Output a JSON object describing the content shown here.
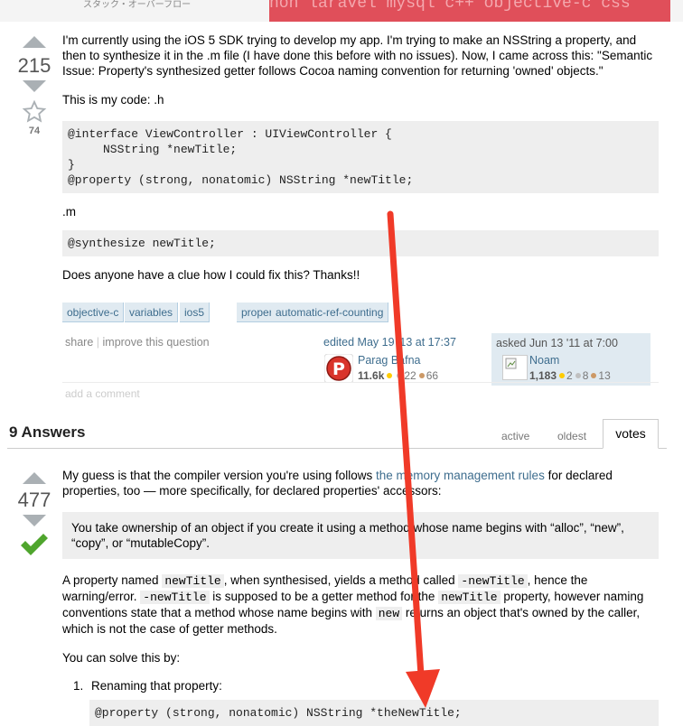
{
  "header": {
    "site_name_jp": "スタック・オーバーフロー",
    "tags_strip": "hon laravel mysql c++ objective-c css"
  },
  "question": {
    "votes": "215",
    "favorites": "74",
    "body_p1": "I'm currently using the iOS 5 SDK trying to develop my app. I'm trying to make an NSString a property, and then to synthesize it in the .m file (I have done this before with no issues). Now, I came across this: \"Semantic Issue: Property's synthesized getter follows Cocoa naming convention for returning 'owned' objects.\"",
    "body_p2": "This is my code: .h",
    "code_h": "@interface ViewController : UIViewController {\n     NSString *newTitle;\n}\n@property (strong, nonatomic) NSString *newTitle;",
    "body_p3": ".m",
    "code_m": "@synthesize newTitle;",
    "body_p4": "Does anyone have a clue how I could fix this? Thanks!!",
    "tags": [
      "objective-c",
      "variables",
      "ios5",
      "properties",
      "automatic-ref-counting"
    ],
    "share": "share",
    "separator": "|",
    "improve": "improve this question",
    "edited": "edited May 19 '13 at 17:37",
    "editor_name": "Parag Bafna",
    "editor_rep": "11.6k",
    "editor_gold": "",
    "editor_silver": "22",
    "editor_bronze": "66",
    "asked": "asked Jun 13 '11 at 7:00",
    "asker_name": "Noam",
    "asker_rep": "1,183",
    "asker_gold": "2",
    "asker_silver": "8",
    "asker_bronze": "13",
    "add_comment": "add a comment"
  },
  "answers_header": {
    "title": "9 Answers",
    "tabs": [
      "active",
      "oldest",
      "votes"
    ],
    "selected_tab": "votes"
  },
  "answer": {
    "votes": "477",
    "accepted": true,
    "p1_before": "My guess is that the compiler version you're using follows ",
    "p1_link": "the memory management rules",
    "p1_after": " for declared properties, too — more specifically, for declared properties' accessors:",
    "quote": "You take ownership of an object if you create it using a method whose name begins with “alloc”, “new”, “copy”, or “mutableCopy”.",
    "p2_a": "A property named ",
    "p2_code1": "newTitle",
    "p2_b": ", when synthesised, yields a method called ",
    "p2_code2": "-newTitle",
    "p2_c": ", hence the warning/error. ",
    "p2_code3": "-newTitle",
    "p2_d": " is supposed to be a getter method for the ",
    "p2_code4": "newTitle",
    "p2_e": " property, however naming conventions state that a method whose name begins with ",
    "p2_code5": "new",
    "p2_f": " returns an object that's owned by the caller, which is not the case of getter methods.",
    "p3": "You can solve this by:",
    "list_num": "1.",
    "list_item": "Renaming that property:",
    "code_fix": "@property (strong, nonatomic) NSString *theNewTitle;"
  },
  "colors": {
    "annotation_arrow": "#f03a28",
    "accepted_check": "#4fa52d",
    "link": "#3e6d8e"
  }
}
